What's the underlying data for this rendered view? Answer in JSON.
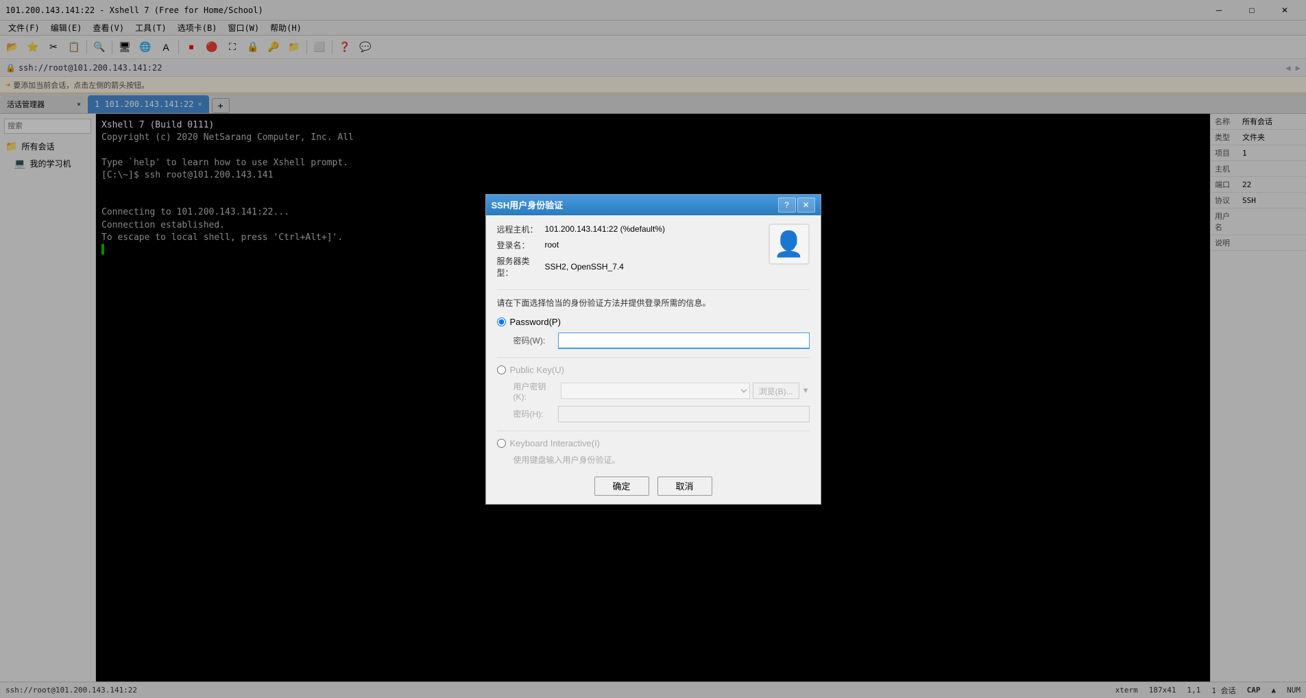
{
  "window": {
    "title": "101.200.143.141:22 - Xshell 7 (Free for Home/School)",
    "min": "─",
    "max": "□",
    "close": "✕"
  },
  "menu": {
    "items": [
      "文件(F)",
      "编辑(E)",
      "查看(V)",
      "工具(T)",
      "选项卡(B)",
      "窗口(W)",
      "帮助(H)"
    ]
  },
  "address_bar": {
    "icon": "🔒",
    "url": "ssh://root@101.200.143.141:22"
  },
  "info_bar": {
    "text": "要添加当前会话，点击左侧的箭头按钮。"
  },
  "tab": {
    "label": "1 101.200.143.141:22",
    "close": "×",
    "add": "+"
  },
  "terminal": {
    "lines": [
      "Xshell 7 (Build 0111)",
      "Copyright (c) 2020 NetSarang Computer, Inc. All",
      "",
      "Type `help' to learn how to use Xshell prompt.",
      "[C:\\~]$ ssh root@101.200.143.141",
      "",
      "",
      "Connecting to 101.200.143.141:22...",
      "Connection established.",
      "To escape to local shell, press 'Ctrl+Alt+]'."
    ],
    "cursor": "▌"
  },
  "sidebar": {
    "search_placeholder": "搜索",
    "sections": [
      {
        "icon": "📁",
        "label": "所有会话"
      },
      {
        "icon": "💻",
        "label": "我的学习机"
      }
    ]
  },
  "props": {
    "rows": [
      {
        "key": "名称",
        "value": "所有会话"
      },
      {
        "key": "类型",
        "value": "文件夹"
      },
      {
        "key": "项目",
        "value": "1"
      },
      {
        "key": "主机",
        "value": ""
      },
      {
        "key": "端口",
        "value": "22"
      },
      {
        "key": "协议",
        "value": "SSH"
      },
      {
        "key": "用户名",
        "value": ""
      },
      {
        "key": "说明",
        "value": ""
      }
    ]
  },
  "status_bar": {
    "path": "ssh://root@101.200.143.141:22",
    "terminal": "xterm",
    "size": "187x41",
    "position": "1,1",
    "sessions": "1 会话",
    "cap": "CAP",
    "num": "NUM",
    "indicator": "▲"
  },
  "dialog": {
    "title": "SSH用户身份验证",
    "help": "?",
    "close": "✕",
    "remote_host_label": "远程主机：",
    "remote_host_value": "101.200.143.141:22 (%default%)",
    "login_label": "登录名：",
    "login_value": "root",
    "server_type_label": "服务器类型：",
    "server_type_value": "SSH2, OpenSSH_7.4",
    "desc": "请在下面选择恰当的身份验证方法并提供登录所需的信息。",
    "password_option": {
      "label": "Password(P)",
      "selected": true
    },
    "password_field": {
      "label": "密码(W):",
      "value": "",
      "placeholder": ""
    },
    "public_key_option": {
      "label": "Public Key(U)",
      "selected": false
    },
    "user_key_label": "用户密钥(K):",
    "user_key_placeholder": "",
    "browse_btn": "浏览(B)...",
    "passphrase_label": "密码(H):",
    "keyboard_option": {
      "label": "Keyboard Interactive(I)",
      "selected": false
    },
    "keyboard_desc": "使用键盘输入用户身份验证。",
    "ok_btn": "确定",
    "cancel_btn": "取消"
  }
}
